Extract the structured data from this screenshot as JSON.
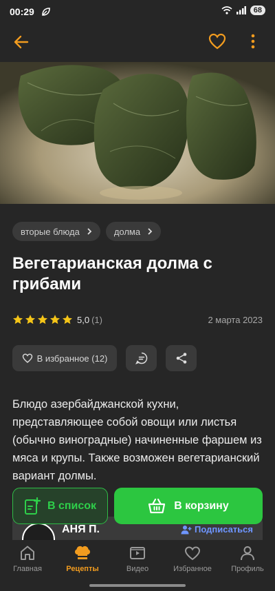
{
  "status": {
    "time": "00:29",
    "battery": "68"
  },
  "colors": {
    "accent": "#f29c1f",
    "green": "#2cc640",
    "link": "#6e95ff",
    "star": "#f5c518"
  },
  "recipe": {
    "tags": [
      {
        "label": "вторые блюда"
      },
      {
        "label": "долма"
      }
    ],
    "title": "Вегетарианская долма с грибами",
    "rating": {
      "value": "5,0",
      "count": "(1)",
      "stars": 5
    },
    "date": "2 марта 2023",
    "favorite_label": "В избранное (12)",
    "description": "Блюдо азербайджанской кухни, представляющее собой овощи или листья (обычно виноградные) начиненные фаршем из мяса и крупы. Также возможен вегетарианский вариант долмы."
  },
  "author": {
    "name": "АНЯ П.",
    "subscribe_label": "Подписаться"
  },
  "buttons": {
    "list_label": "В список",
    "cart_label": "В корзину"
  },
  "nav": {
    "items": [
      {
        "label": "Главная",
        "icon": "home-icon"
      },
      {
        "label": "Рецепты",
        "icon": "chef-hat-icon",
        "active": true
      },
      {
        "label": "Видео",
        "icon": "video-icon"
      },
      {
        "label": "Избранное",
        "icon": "heart-icon"
      },
      {
        "label": "Профиль",
        "icon": "profile-icon"
      }
    ]
  }
}
